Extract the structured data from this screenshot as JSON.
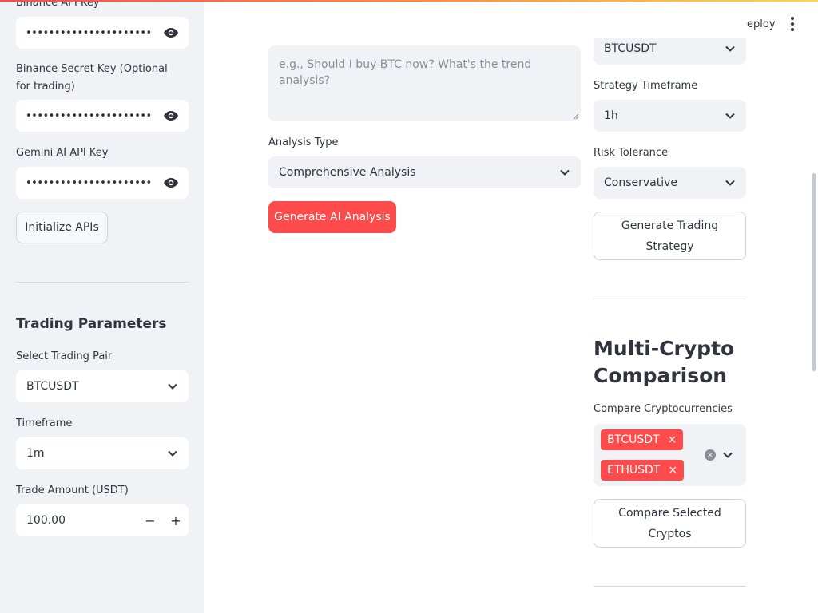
{
  "header": {
    "deploy_label": "Deploy",
    "menu_icon": "kebab-menu-icon"
  },
  "sidebar": {
    "binance_api_key": {
      "label": "Binance API Key",
      "value": "••••••••••••••••••••••••••••••••"
    },
    "binance_secret_key": {
      "label": "Binance Secret Key (Optional for trading)",
      "value": "••••••••••••••••••••••••••••••••"
    },
    "gemini_api_key": {
      "label": "Gemini AI API Key",
      "value": "••••••••••••••••••••••••••••••••"
    },
    "initialize_button": "Initialize APIs",
    "trading_parameters": {
      "title": "Trading Parameters",
      "pair_label": "Select Trading Pair",
      "pair_value": "BTCUSDT",
      "timeframe_label": "Timeframe",
      "timeframe_value": "1m",
      "amount_label": "Trade Amount (USDT)",
      "amount_value": "100.00",
      "minus": "−",
      "plus": "+"
    }
  },
  "main": {
    "question_placeholder": "e.g., Should I buy BTC now? What's the trend analysis?",
    "analysis_type_label": "Analysis Type",
    "analysis_type_value": "Comprehensive Analysis",
    "generate_button": "Generate AI Analysis"
  },
  "strategy": {
    "pair_value": "BTCUSDT",
    "timeframe_label": "Strategy Timeframe",
    "timeframe_value": "1h",
    "risk_label": "Risk Tolerance",
    "risk_value": "Conservative",
    "generate_button": "Generate Trading Strategy"
  },
  "comparison": {
    "title": "Multi-Crypto Comparison",
    "label": "Compare Cryptocurrencies",
    "selected": [
      "BTCUSDT",
      "ETHUSDT"
    ],
    "remove_glyph": "×",
    "clear_glyph": "×",
    "compare_button": "Compare Selected Cryptos"
  },
  "colors": {
    "accent": "#ff4b4b",
    "sidebar_bg": "#f0f2f6",
    "text": "#31333f"
  }
}
